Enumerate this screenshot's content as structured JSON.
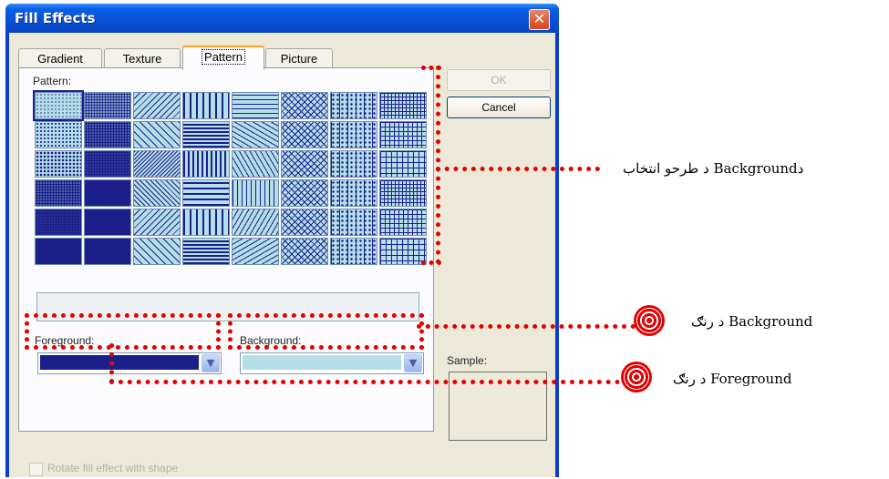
{
  "window": {
    "title": "Fill Effects",
    "close_glyph": "✕"
  },
  "tabs": [
    {
      "label": "Gradient"
    },
    {
      "label": "Texture"
    },
    {
      "label": "Pattern"
    },
    {
      "label": "Picture"
    }
  ],
  "pattern": {
    "label": "Pattern:",
    "rows": 6,
    "columns": 8,
    "selected_index": 0,
    "colors": {
      "foreground": "#1b1f8a",
      "background": "#b4dfe9"
    }
  },
  "foreground": {
    "label": "Foreground:",
    "color": "#1b1f8a"
  },
  "background": {
    "label": "Background:",
    "color": "#b4dfe9"
  },
  "buttons": {
    "ok": "OK",
    "cancel": "Cancel"
  },
  "sample": {
    "label": "Sample:"
  },
  "rotate": {
    "label": "Rotate fill effect with shape",
    "checked": false
  },
  "annotations": {
    "pattern_choice": "دBackground د طرحو انتخاب",
    "background_color": "د رنګ  Background",
    "foreground_color": "د رنګ  Foreground",
    "color": "#e40000"
  }
}
